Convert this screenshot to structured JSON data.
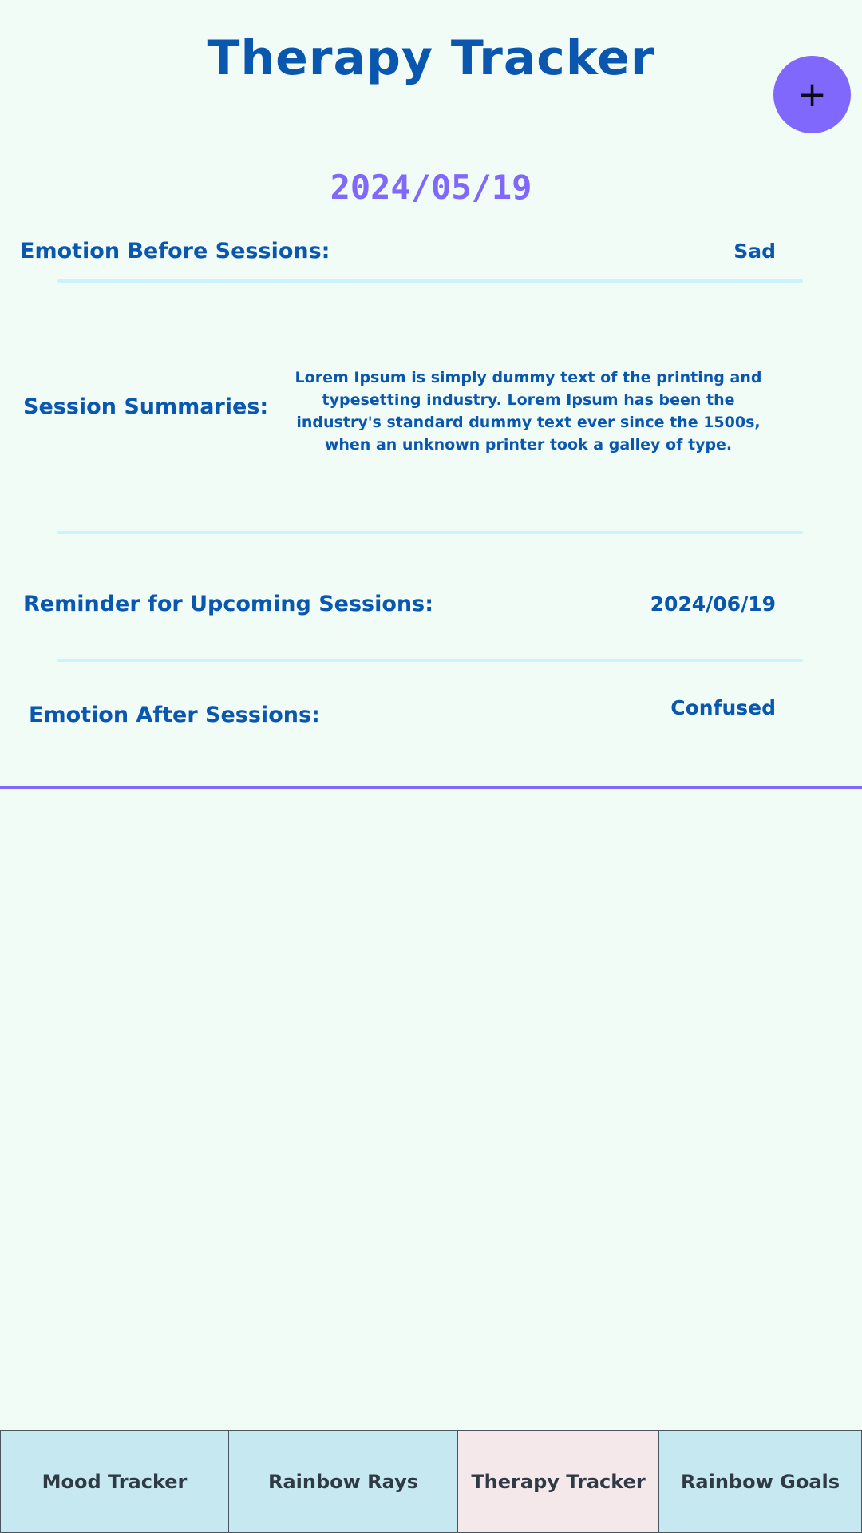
{
  "header": {
    "title": "Therapy Tracker",
    "add_button_icon": "plus-icon",
    "add_button_glyph": "+"
  },
  "session": {
    "date": "2024/05/19",
    "emotion_before_label": "Emotion Before Sessions:",
    "emotion_before_value": "Sad",
    "summary_label": "Session Summaries:",
    "summary_text": "Lorem Ipsum is simply dummy text of the printing and typesetting industry. Lorem Ipsum has been the industry's standard dummy text ever since the 1500s, when an unknown printer took a galley of type.",
    "reminder_label": "Reminder for Upcoming Sessions:",
    "reminder_value": "2024/06/19",
    "emotion_after_label": "Emotion After Sessions:",
    "emotion_after_value": "Confused"
  },
  "tabs": [
    {
      "label": "Mood Tracker",
      "active": false
    },
    {
      "label": "Rainbow Rays",
      "active": false
    },
    {
      "label": "Therapy Tracker",
      "active": true
    },
    {
      "label": "Rainbow Goals",
      "active": false
    }
  ],
  "colors": {
    "background": "#f2fcf7",
    "primary_text": "#0a57b0",
    "accent": "#8168fc",
    "divider": "#cbf3fb",
    "tab_background": "#c5e8f1",
    "tab_active_background": "#f5e8ea"
  }
}
